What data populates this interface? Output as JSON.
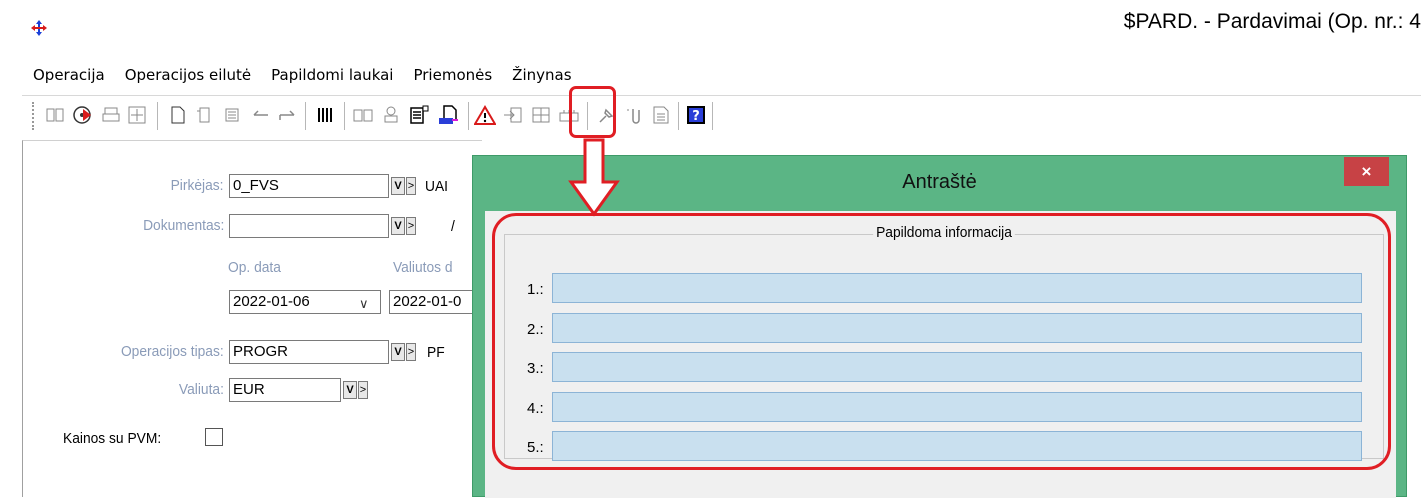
{
  "window": {
    "title": "$PARD. - Pardavimai (Op. nr.: 4",
    "icon": "app-cross-arrows-icon"
  },
  "menu": [
    "Operacija",
    "Operacijos eilutė",
    "Papildomi laukai",
    "Priemonės",
    "Žinynas"
  ],
  "toolbar_icons": [
    "book-icon",
    "cd-run-icon",
    "print-icon",
    "move-icon",
    "new-document-icon",
    "copy-document-icon",
    "delete-document-icon",
    "undo-icon",
    "redo-icon",
    "columns-icon",
    "open-book-icon",
    "stamp-icon",
    "additional-info-icon",
    "print-preview-icon",
    "warning-icon",
    "import-icon",
    "grid-icon",
    "link-icon",
    "pin-icon",
    "attachment-icon",
    "notes-icon",
    "help-icon"
  ],
  "form": {
    "buyer_label": "Pirkėjas:",
    "buyer_value": "0_FVS",
    "buyer_name_partial": "UAI",
    "document_label": "Dokumentas:",
    "document_value": "",
    "document_sep": "/",
    "op_date_label": "Op. data",
    "currency_date_label": "Valiutos d",
    "op_date_value": "2022-01-06",
    "currency_date_value": "2022-01-0",
    "op_type_label": "Operacijos tipas:",
    "op_type_value": "PROGR",
    "op_type_name_partial": "PF",
    "currency_label": "Valiuta:",
    "currency_value": "EUR",
    "prices_vat_label": "Kainos su PVM:",
    "v_button": "V",
    "arrow_button": ">",
    "dropdown_arrow": "∨"
  },
  "dialog": {
    "title": "Antraštė",
    "close": "×",
    "group_title": "Papildoma informacija",
    "rows": [
      {
        "label": "1.:",
        "value": ""
      },
      {
        "label": "2.:",
        "value": ""
      },
      {
        "label": "3.:",
        "value": ""
      },
      {
        "label": "4.:",
        "value": ""
      },
      {
        "label": "5.:",
        "value": ""
      }
    ]
  },
  "colors": {
    "dialog_frame": "#5bb585",
    "close_button": "#c74245",
    "input_fill": "#c9e0ef",
    "annotation": "#e01e24",
    "label_muted": "#8a9bb8"
  }
}
